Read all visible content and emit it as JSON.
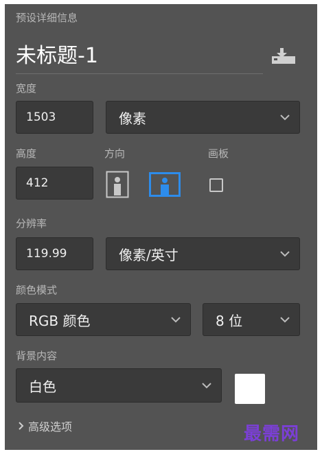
{
  "panel": {
    "section_title": "预设详细信息",
    "document_title": "未标题-1",
    "save_preset_icon": "save-preset-icon"
  },
  "width": {
    "label": "宽度",
    "value": "1503",
    "unit": "像素"
  },
  "height": {
    "label": "高度",
    "value": "412"
  },
  "orientation": {
    "label": "方向",
    "options": [
      "portrait",
      "landscape"
    ],
    "selected": "landscape"
  },
  "artboard": {
    "label": "画板",
    "checked": false
  },
  "resolution": {
    "label": "分辨率",
    "value": "119.99",
    "unit": "像素/英寸"
  },
  "color_mode": {
    "label": "颜色模式",
    "mode": "RGB 颜色",
    "bit_depth": "8 位"
  },
  "background": {
    "label": "背景内容",
    "value": "白色",
    "swatch_color": "#ffffff"
  },
  "advanced": {
    "label": "高级选项"
  },
  "watermark": "最需网",
  "colors": {
    "panel_bg": "#535353",
    "field_bg": "#3a3a3a",
    "accent": "#2d8ceb"
  }
}
